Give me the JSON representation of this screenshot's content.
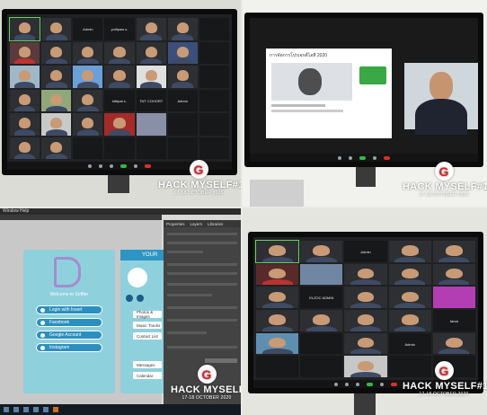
{
  "watermark": {
    "logo_letter": "G",
    "title": "HACK MYSELF#1",
    "date": "17-18 OCTOBER 2020",
    "accent": "#d8232a"
  },
  "panel1": {
    "tile_labels": [
      "Admin",
      "yolitpaw s.",
      "kittipat s.",
      "TNT COHORT",
      "Admin"
    ]
  },
  "panel2": {
    "shared_title": "การจัดการโปรเจกต์ไอที 2020"
  },
  "panel3": {
    "window_menu": [
      "Window",
      "Help"
    ],
    "app_title": "YOUR",
    "welcome": "Welcome  to  Softfer",
    "buttons": [
      "Login  with  Insert",
      "Facebook",
      "Google Account",
      "Instagram"
    ],
    "side_menu": [
      "Photos & Images",
      "Music Tracks",
      "Contact List",
      "Messages",
      "Calendar"
    ],
    "props_tabs": [
      "Properties",
      "Layers",
      "Libraries"
    ]
  },
  "panel4": {
    "tile_labels": [
      "Admin",
      "ELZOC ADMIN",
      "tanat",
      "Admin"
    ]
  }
}
